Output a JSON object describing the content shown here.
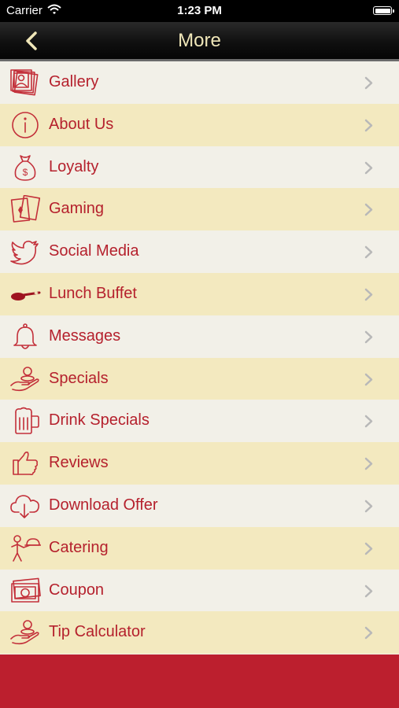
{
  "status_bar": {
    "carrier": "Carrier",
    "time": "1:23 PM"
  },
  "navbar": {
    "title": "More"
  },
  "menu": [
    {
      "label": "Gallery",
      "icon": "gallery-icon"
    },
    {
      "label": "About Us",
      "icon": "info-icon"
    },
    {
      "label": "Loyalty",
      "icon": "money-bag-icon"
    },
    {
      "label": "Gaming",
      "icon": "playing-cards-icon"
    },
    {
      "label": "Social Media",
      "icon": "twitter-bird-icon"
    },
    {
      "label": "Lunch Buffet",
      "icon": "ladle-icon"
    },
    {
      "label": "Messages",
      "icon": "bell-icon"
    },
    {
      "label": "Specials",
      "icon": "hand-coins-icon"
    },
    {
      "label": "Drink Specials",
      "icon": "beer-mug-icon"
    },
    {
      "label": "Reviews",
      "icon": "thumbs-up-icon"
    },
    {
      "label": "Download Offer",
      "icon": "cloud-download-icon"
    },
    {
      "label": "Catering",
      "icon": "waiter-icon"
    },
    {
      "label": "Coupon",
      "icon": "banknote-icon"
    },
    {
      "label": "Tip Calculator",
      "icon": "hand-coins-icon"
    }
  ],
  "colors": {
    "label": "#b5212d",
    "row_light": "#f2f0e8",
    "row_dark": "#f3e9bf",
    "footer": "#bc1f2e",
    "nav_title": "#efe6b8"
  }
}
